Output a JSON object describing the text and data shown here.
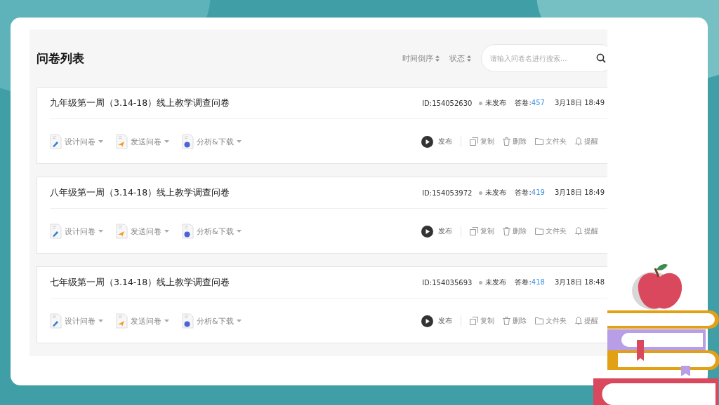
{
  "title": "问卷列表",
  "sorts": [
    {
      "label": "时间倒序"
    },
    {
      "label": "状态"
    }
  ],
  "search": {
    "placeholder": "请输入问卷名进行搜索..."
  },
  "surveys": [
    {
      "name": "九年级第一周（3.14-18）线上教学调查问卷",
      "id": "ID:154052630",
      "published": false,
      "status": "未发布",
      "answers_label": "答卷:",
      "answers": "457",
      "date": "3月18日 18:49",
      "tools": [
        {
          "kind": "design",
          "label": "设计问卷"
        },
        {
          "kind": "send",
          "label": "发送问卷"
        },
        {
          "kind": "analyze",
          "label": "分析&下载"
        }
      ],
      "actions": [
        {
          "kind": "publish",
          "label": "发布"
        },
        {
          "kind": "copy",
          "label": "复制"
        },
        {
          "kind": "delete",
          "label": "删除"
        },
        {
          "kind": "folder",
          "label": "文件夹"
        },
        {
          "kind": "remind",
          "label": "提醒"
        }
      ]
    },
    {
      "name": "八年级第一周（3.14-18）线上教学调查问卷",
      "id": "ID:154053972",
      "published": false,
      "status": "未发布",
      "answers_label": "答卷:",
      "answers": "419",
      "date": "3月18日 18:49",
      "tools": [
        {
          "kind": "design",
          "label": "设计问卷"
        },
        {
          "kind": "send",
          "label": "发送问卷"
        },
        {
          "kind": "analyze",
          "label": "分析&下载"
        }
      ],
      "actions": [
        {
          "kind": "publish",
          "label": "发布"
        },
        {
          "kind": "copy",
          "label": "复制"
        },
        {
          "kind": "delete",
          "label": "删除"
        },
        {
          "kind": "folder",
          "label": "文件夹"
        },
        {
          "kind": "remind",
          "label": "提醒"
        }
      ]
    },
    {
      "name": "七年级第一周（3.14-18）线上教学调查问卷",
      "id": "ID:154035693",
      "published": false,
      "status": "未发布",
      "answers_label": "答卷:",
      "answers": "418",
      "date": "3月18日 18:48",
      "tools": [
        {
          "kind": "design",
          "label": "设计问卷"
        },
        {
          "kind": "send",
          "label": "发送问卷"
        },
        {
          "kind": "analyze",
          "label": "分析&下载"
        }
      ],
      "actions": [
        {
          "kind": "publish",
          "label": "发布"
        },
        {
          "kind": "copy",
          "label": "复制"
        },
        {
          "kind": "delete",
          "label": "删除"
        },
        {
          "kind": "folder",
          "label": "文件夹"
        },
        {
          "kind": "remind",
          "label": "提醒"
        }
      ]
    }
  ]
}
